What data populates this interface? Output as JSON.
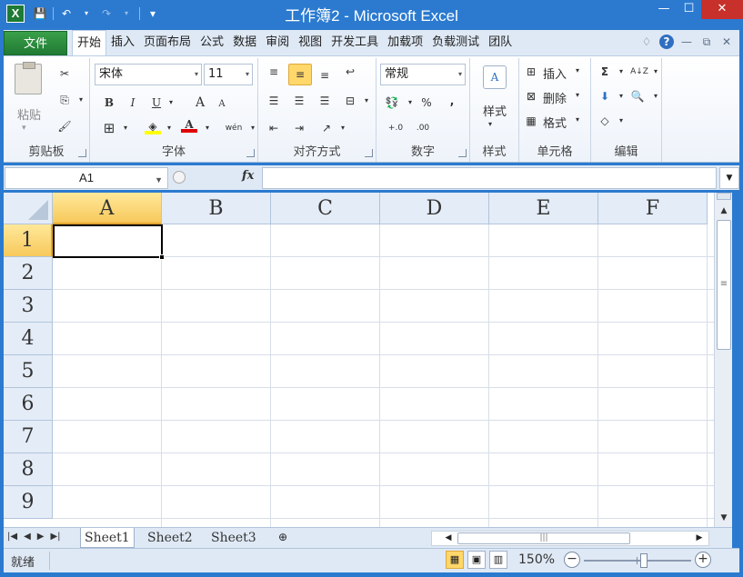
{
  "window": {
    "title": "工作簿2 - Microsoft Excel",
    "app_icon": "X",
    "controls": {
      "minimize": "—",
      "maximize": "☐",
      "close": "✕"
    }
  },
  "quick_access": {
    "save": "💾",
    "undo": "↶",
    "redo": "↷",
    "customize": "▾"
  },
  "ribbon": {
    "file_tab": "文件",
    "tabs": [
      "开始",
      "插入",
      "页面布局",
      "公式",
      "数据",
      "审阅",
      "视图",
      "开发工具",
      "加载项",
      "负载测试",
      "团队"
    ],
    "active_tab": "开始",
    "right_icons": {
      "collapse": "♢",
      "help": "?",
      "min": "—",
      "restore": "⧉",
      "close": "✕"
    },
    "groups": {
      "clipboard": {
        "label": "剪贴板",
        "paste": "粘贴",
        "cut": "✂",
        "copy": "⎘",
        "format_painter": "🖌"
      },
      "font": {
        "label": "字体",
        "font_name": "宋体",
        "font_size": "11",
        "bold": "B",
        "italic": "I",
        "underline": "U",
        "grow": "A",
        "shrink": "A",
        "border": "⊞",
        "fill": "◈",
        "font_color": "A",
        "phonetic": "wén"
      },
      "alignment": {
        "label": "对齐方式"
      },
      "number": {
        "label": "数字",
        "format": "常规",
        "currency": "💱",
        "percent": "%",
        "comma": ","
      },
      "styles": {
        "label": "样式",
        "button": "样式"
      },
      "cells": {
        "label": "单元格",
        "insert": "插入",
        "delete": "删除",
        "format": "格式"
      },
      "editing": {
        "label": "编辑",
        "sum": "Σ",
        "sort": "A↓Z",
        "fill": "⬇",
        "find": "🔍",
        "clear": "◇"
      }
    }
  },
  "formula_bar": {
    "name_box": "A1",
    "fx": "fx",
    "value": ""
  },
  "grid": {
    "columns": [
      "A",
      "B",
      "C",
      "D",
      "E",
      "F"
    ],
    "rows": [
      "1",
      "2",
      "3",
      "4",
      "5",
      "6",
      "7",
      "8",
      "9"
    ],
    "active_cell": "A1"
  },
  "sheets": {
    "tabs": [
      "Sheet1",
      "Sheet2",
      "Sheet3"
    ],
    "active": "Sheet1"
  },
  "status": {
    "ready": "就绪",
    "zoom": "150%"
  },
  "colors": {
    "title_bar": "#2b7ad0",
    "file_tab": "#2a8c3e",
    "selected_header": "#f7c95b",
    "close_button": "#c7302b"
  }
}
